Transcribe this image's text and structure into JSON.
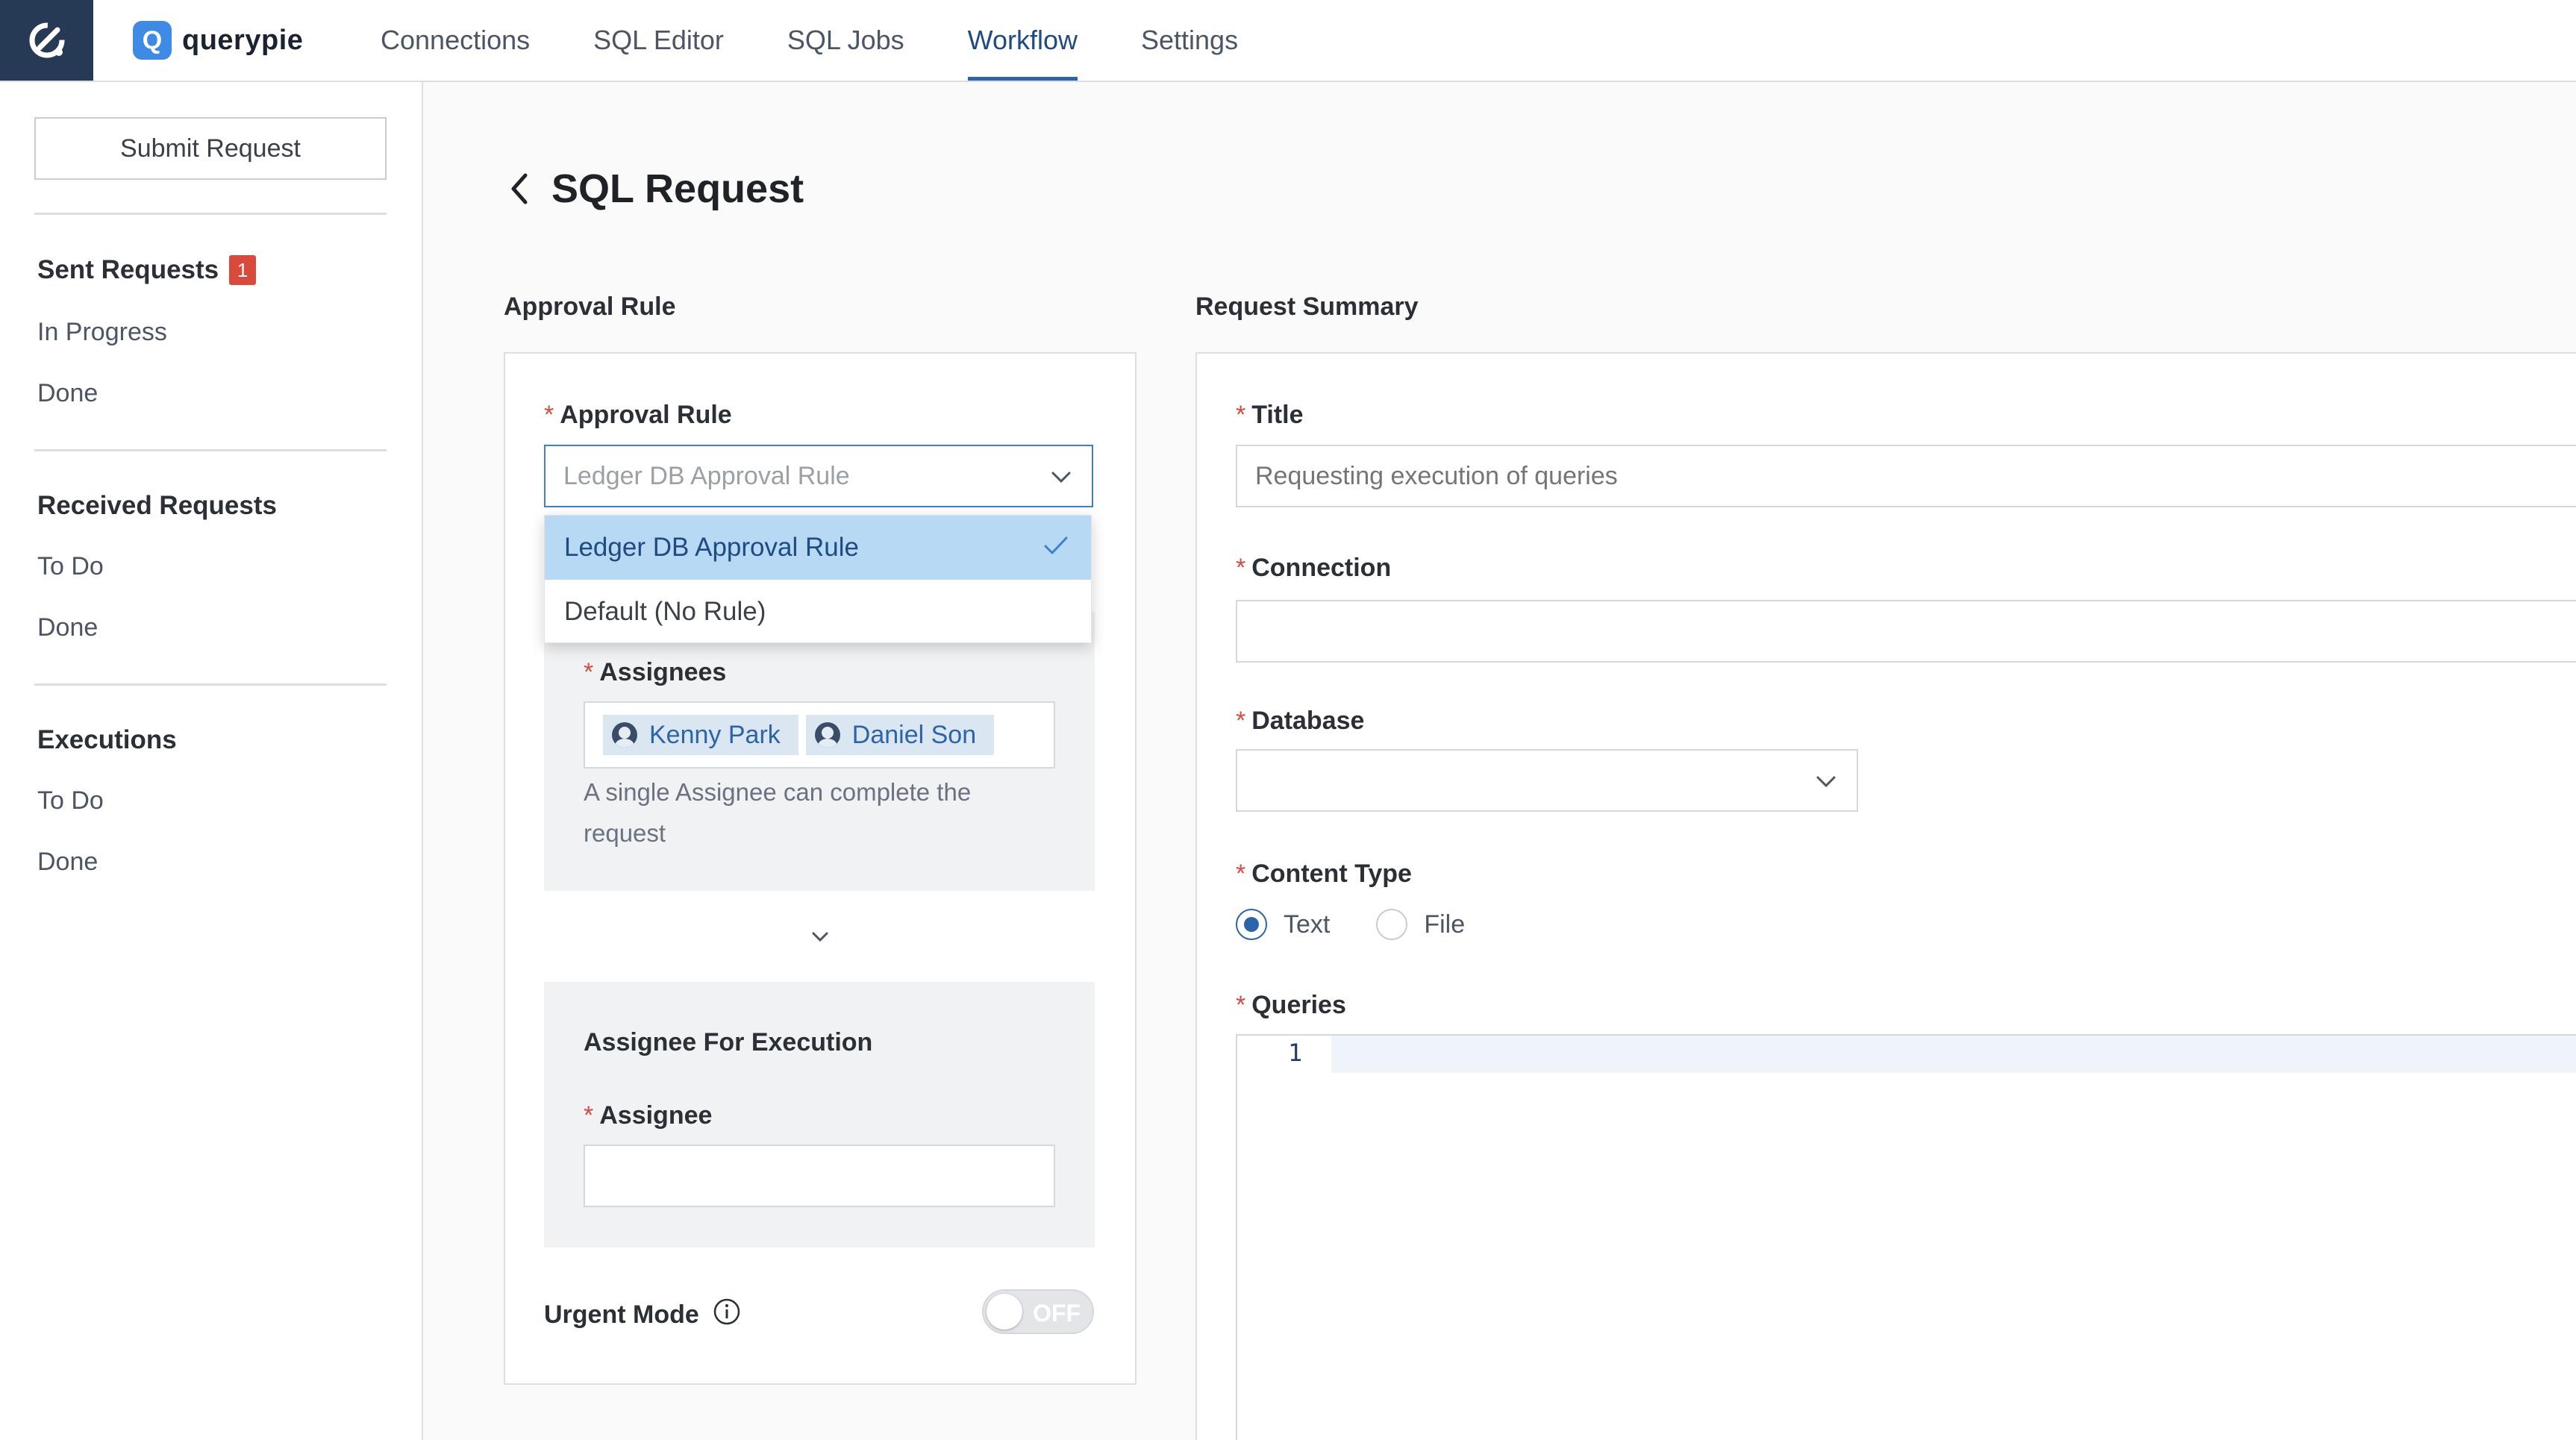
{
  "brand": {
    "name": "querypie",
    "logo_letter": "Q"
  },
  "nav": {
    "items": [
      "Connections",
      "SQL Editor",
      "SQL Jobs",
      "Workflow",
      "Settings"
    ],
    "active": "Workflow"
  },
  "sidebar": {
    "submit_label": "Submit Request",
    "sent": {
      "title": "Sent Requests",
      "badge": "1",
      "links": [
        "In Progress",
        "Done"
      ]
    },
    "received": {
      "title": "Received Requests",
      "links": [
        "To Do",
        "Done"
      ]
    },
    "executions": {
      "title": "Executions",
      "links": [
        "To Do",
        "Done"
      ]
    }
  },
  "page": {
    "title": "SQL Request"
  },
  "approval": {
    "section_title": "Approval Rule",
    "rule_label": "Approval Rule",
    "rule_placeholder": "Ledger DB Approval Rule",
    "options": [
      "Ledger DB Approval Rule",
      "Default (No Rule)"
    ],
    "selected_option": "Ledger DB Approval Rule",
    "assignees_label": "Assignees",
    "assignees": [
      "Kenny Park",
      "Daniel Son"
    ],
    "assignees_help": "A single Assignee can complete the request",
    "execution_title": "Assignee For Execution",
    "execution_label": "Assignee",
    "execution_value": "",
    "urgent_label": "Urgent Mode",
    "urgent_state": "OFF"
  },
  "summary": {
    "section_title": "Request Summary",
    "title_label": "Title",
    "title_placeholder": "Requesting execution of queries",
    "connection_label": "Connection",
    "connection_value": "",
    "database_label": "Database",
    "database_value": "",
    "content_type_label": "Content Type",
    "content_type_options": [
      "Text",
      "File"
    ],
    "content_type_selected": "Text",
    "queries_label": "Queries",
    "editor_line": "1"
  },
  "colors": {
    "accent": "#2b64a8",
    "required": "#d94a3d",
    "nav_bg": "#273a55"
  }
}
